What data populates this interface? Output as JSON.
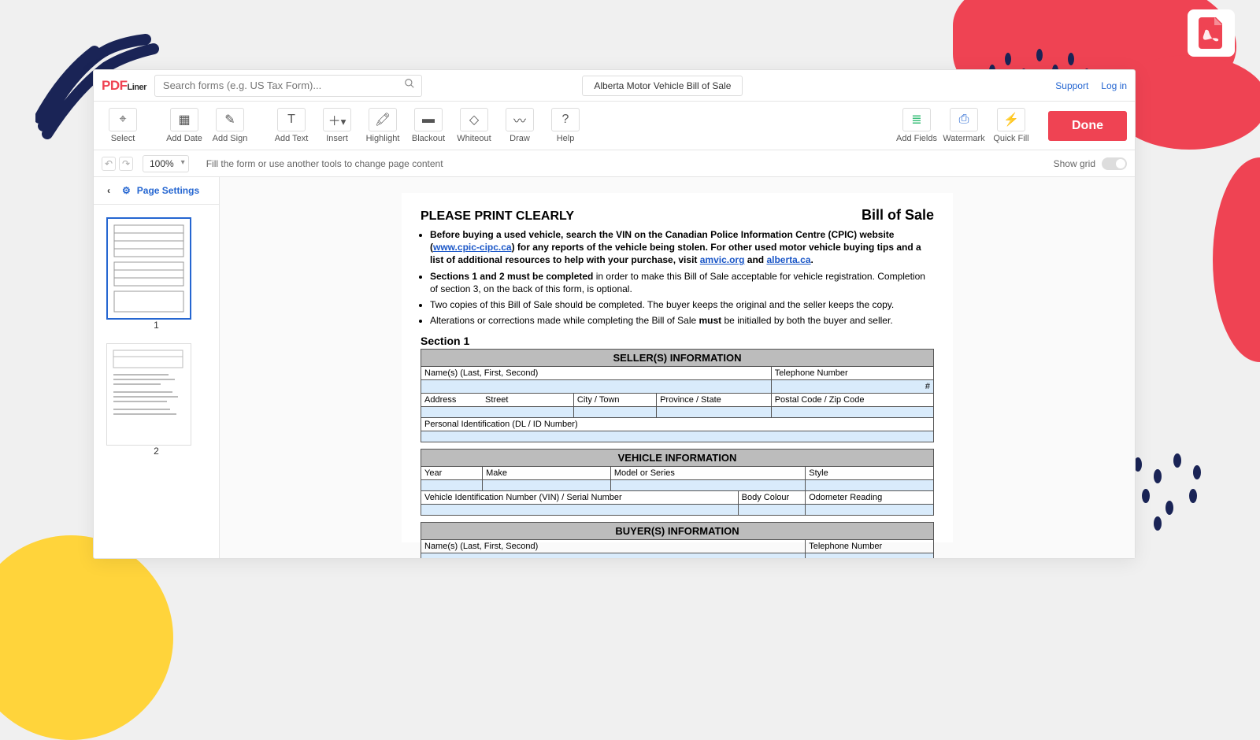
{
  "header": {
    "logo_pdf": "PDF",
    "logo_liner": "Liner",
    "search_placeholder": "Search forms (e.g. US Tax Form)...",
    "doc_title": "Alberta Motor Vehicle Bill of Sale",
    "support": "Support",
    "login": "Log in"
  },
  "toolbar": {
    "select": "Select",
    "add_date": "Add Date",
    "add_sign": "Add Sign",
    "add_text": "Add Text",
    "insert": "Insert",
    "highlight": "Highlight",
    "blackout": "Blackout",
    "whiteout": "Whiteout",
    "draw": "Draw",
    "help": "Help",
    "add_fields": "Add Fields",
    "watermark": "Watermark",
    "quick_fill": "Quick Fill",
    "done": "Done"
  },
  "subbar": {
    "zoom": "100%",
    "hint": "Fill the form or use another tools to change page content",
    "show_grid": "Show grid"
  },
  "sidebar": {
    "page_settings": "Page Settings",
    "pages": [
      "1",
      "2"
    ]
  },
  "doc": {
    "print_clearly": "PLEASE PRINT CLEARLY",
    "bill_of_sale": "Bill of Sale",
    "bul1a": "Before buying a used vehicle, search the VIN on the Canadian Police Information Centre (CPIC) website (",
    "bul1_link1": "www.cpic-cipc.ca",
    "bul1b": ") for any reports of the vehicle being stolen. For other used motor vehicle buying tips and a list of additional resources to help with your purchase, visit ",
    "bul1_link2": "amvic.org",
    "bul1c": " and ",
    "bul1_link3": "alberta.ca",
    "bul1d": ".",
    "bul2a": "Sections 1 and 2 must be completed",
    "bul2b": " in order to make this Bill of Sale acceptable for vehicle registration. Completion of section 3, on the back of this form, is optional.",
    "bul3": "Two copies of this Bill of Sale should be completed. The buyer keeps the original and the seller keeps the copy.",
    "bul4a": "Alterations or corrections made while completing the Bill of Sale ",
    "bul4b": "must",
    "bul4c": " be initialled by both the buyer and seller.",
    "section1": "Section 1",
    "seller_info": "SELLER(S) INFORMATION",
    "names": "Name(s) (Last, First, Second)",
    "telephone": "Telephone Number",
    "hash": "#",
    "address": "Address",
    "street": "Street",
    "city": "City / Town",
    "province": "Province / State",
    "postal": "Postal Code / Zip Code",
    "pid": "Personal Identification (DL / ID Number)",
    "vehicle_info": "VEHICLE INFORMATION",
    "year": "Year",
    "make": "Make",
    "model": "Model or Series",
    "style": "Style",
    "vin": "Vehicle Identification Number (VIN) / Serial Number",
    "body_colour": "Body Colour",
    "odometer": "Odometer Reading",
    "buyer_info": "BUYER(S) INFORMATION"
  }
}
